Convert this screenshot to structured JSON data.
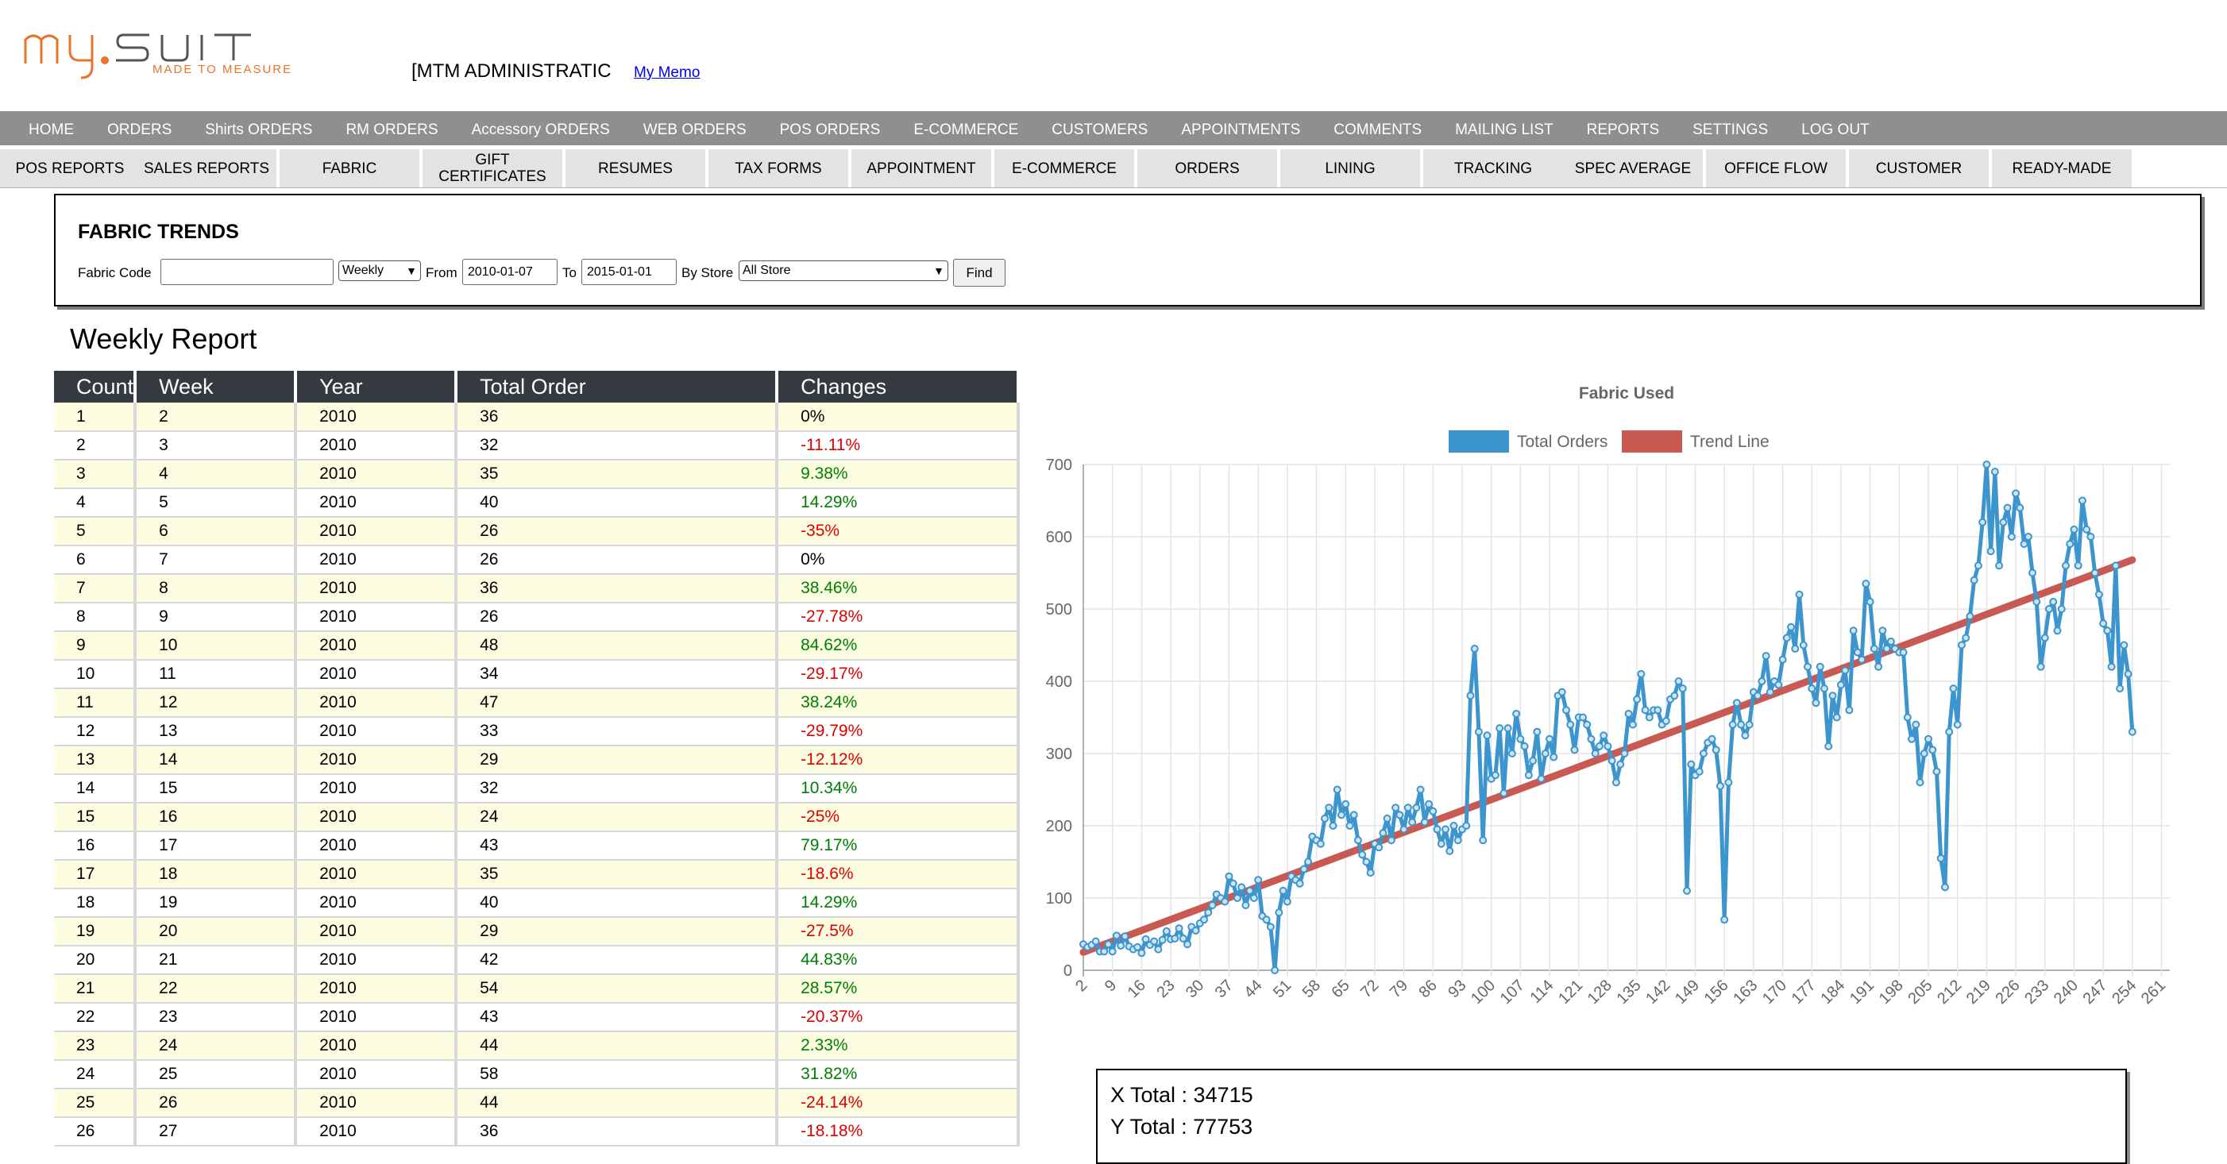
{
  "header": {
    "logo_main": "my.suit",
    "logo_tagline": "MADE TO MEASURE",
    "admin_title": "[MTM ADMINISTRATIC",
    "memo_link": "My Memo"
  },
  "main_nav": [
    "HOME",
    "ORDERS",
    "Shirts ORDERS",
    "RM ORDERS",
    "Accessory ORDERS",
    "WEB ORDERS",
    "POS ORDERS",
    "E-COMMERCE",
    "CUSTOMERS",
    "APPOINTMENTS",
    "COMMENTS",
    "MAILING LIST",
    "REPORTS",
    "SETTINGS",
    "LOG OUT"
  ],
  "sub_nav": [
    "POS REPORTS",
    "SALES REPORTS",
    "FABRIC",
    "GIFT CERTIFICATES",
    "RESUMES",
    "TAX FORMS",
    "APPOINTMENT",
    "E-COMMERCE",
    "ORDERS",
    "LINING",
    "TRACKING",
    "SPEC AVERAGE",
    "OFFICE FLOW",
    "CUSTOMER",
    "READY-MADE"
  ],
  "filter": {
    "title": "FABRIC TRENDS",
    "fabric_code_label": "Fabric Code",
    "fabric_code_value": "",
    "period_value": "Weekly",
    "from_label": "From",
    "from_value": "2010-01-07",
    "to_label": "To",
    "to_value": "2015-01-01",
    "store_label": "By Store",
    "store_value": "All Store",
    "find_label": "Find"
  },
  "report": {
    "title": "Weekly Report",
    "columns": [
      "Count",
      "Week",
      "Year",
      "Total Order",
      "Changes"
    ],
    "rows": [
      [
        "1",
        "2",
        "2010",
        "36",
        "0%"
      ],
      [
        "2",
        "3",
        "2010",
        "32",
        "-11.11%"
      ],
      [
        "3",
        "4",
        "2010",
        "35",
        "9.38%"
      ],
      [
        "4",
        "5",
        "2010",
        "40",
        "14.29%"
      ],
      [
        "5",
        "6",
        "2010",
        "26",
        "-35%"
      ],
      [
        "6",
        "7",
        "2010",
        "26",
        "0%"
      ],
      [
        "7",
        "8",
        "2010",
        "36",
        "38.46%"
      ],
      [
        "8",
        "9",
        "2010",
        "26",
        "-27.78%"
      ],
      [
        "9",
        "10",
        "2010",
        "48",
        "84.62%"
      ],
      [
        "10",
        "11",
        "2010",
        "34",
        "-29.17%"
      ],
      [
        "11",
        "12",
        "2010",
        "47",
        "38.24%"
      ],
      [
        "12",
        "13",
        "2010",
        "33",
        "-29.79%"
      ],
      [
        "13",
        "14",
        "2010",
        "29",
        "-12.12%"
      ],
      [
        "14",
        "15",
        "2010",
        "32",
        "10.34%"
      ],
      [
        "15",
        "16",
        "2010",
        "24",
        "-25%"
      ],
      [
        "16",
        "17",
        "2010",
        "43",
        "79.17%"
      ],
      [
        "17",
        "18",
        "2010",
        "35",
        "-18.6%"
      ],
      [
        "18",
        "19",
        "2010",
        "40",
        "14.29%"
      ],
      [
        "19",
        "20",
        "2010",
        "29",
        "-27.5%"
      ],
      [
        "20",
        "21",
        "2010",
        "42",
        "44.83%"
      ],
      [
        "21",
        "22",
        "2010",
        "54",
        "28.57%"
      ],
      [
        "22",
        "23",
        "2010",
        "43",
        "-20.37%"
      ],
      [
        "23",
        "24",
        "2010",
        "44",
        "2.33%"
      ],
      [
        "24",
        "25",
        "2010",
        "58",
        "31.82%"
      ],
      [
        "25",
        "26",
        "2010",
        "44",
        "-24.14%"
      ],
      [
        "26",
        "27",
        "2010",
        "36",
        "-18.18%"
      ]
    ]
  },
  "chart_data": {
    "type": "line",
    "title": "Fabric Used",
    "legend_position": "top",
    "ylim": [
      0,
      700
    ],
    "yticks": [
      0,
      100,
      200,
      300,
      400,
      500,
      600,
      700
    ],
    "xticks": [
      2,
      9,
      16,
      23,
      30,
      37,
      44,
      51,
      58,
      65,
      72,
      79,
      86,
      93,
      100,
      107,
      114,
      121,
      128,
      135,
      142,
      149,
      156,
      163,
      170,
      177,
      184,
      191,
      198,
      205,
      212,
      219,
      226,
      233,
      240,
      247,
      254,
      261
    ],
    "xlim": [
      2,
      263
    ],
    "grid": true,
    "series": [
      {
        "name": "Total Orders",
        "color": "#3d95cd",
        "x_start": 2,
        "values": [
          36,
          32,
          35,
          40,
          26,
          26,
          36,
          26,
          48,
          34,
          47,
          33,
          29,
          32,
          24,
          43,
          35,
          40,
          29,
          42,
          54,
          43,
          44,
          58,
          44,
          36,
          60,
          55,
          65,
          70,
          80,
          90,
          105,
          100,
          95,
          130,
          120,
          100,
          115,
          90,
          110,
          100,
          125,
          75,
          70,
          60,
          0,
          80,
          110,
          95,
          130,
          125,
          120,
          140,
          150,
          185,
          180,
          175,
          210,
          225,
          200,
          250,
          215,
          230,
          200,
          215,
          180,
          160,
          150,
          135,
          175,
          170,
          190,
          210,
          180,
          225,
          215,
          195,
          225,
          205,
          225,
          250,
          205,
          230,
          220,
          195,
          175,
          195,
          165,
          200,
          180,
          195,
          200,
          380,
          445,
          330,
          180,
          325,
          265,
          270,
          335,
          245,
          335,
          300,
          355,
          320,
          310,
          270,
          290,
          330,
          265,
          300,
          320,
          295,
          380,
          385,
          360,
          340,
          305,
          350,
          350,
          340,
          320,
          300,
          310,
          325,
          310,
          290,
          260,
          285,
          300,
          355,
          340,
          375,
          410,
          360,
          350,
          360,
          360,
          340,
          345,
          375,
          380,
          400,
          390,
          110,
          285,
          270,
          275,
          300,
          315,
          320,
          305,
          255,
          70,
          260,
          340,
          370,
          340,
          325,
          340,
          385,
          380,
          400,
          435,
          385,
          400,
          395,
          430,
          460,
          475,
          445,
          520,
          450,
          420,
          390,
          370,
          420,
          390,
          310,
          380,
          350,
          395,
          415,
          360,
          470,
          440,
          430,
          535,
          510,
          445,
          420,
          470,
          445,
          455,
          445,
          440,
          440,
          350,
          320,
          340,
          260,
          300,
          320,
          305,
          275,
          155,
          115,
          330,
          390,
          340,
          450,
          460,
          490,
          540,
          560,
          620,
          700,
          580,
          690,
          560,
          620,
          640,
          600,
          660,
          640,
          590,
          600,
          550,
          510,
          420,
          460,
          500,
          510,
          470,
          500,
          560,
          590,
          610,
          560,
          650,
          610,
          600,
          550,
          520,
          480,
          470,
          420,
          560,
          390,
          450,
          410,
          330
        ]
      },
      {
        "name": "Trend Line",
        "color": "#c95a53",
        "x_start": 2,
        "start_value": 25,
        "end_value": 568
      }
    ]
  },
  "totals": {
    "x_total": "X Total : 34715",
    "y_total": "Y Total : 77753"
  }
}
